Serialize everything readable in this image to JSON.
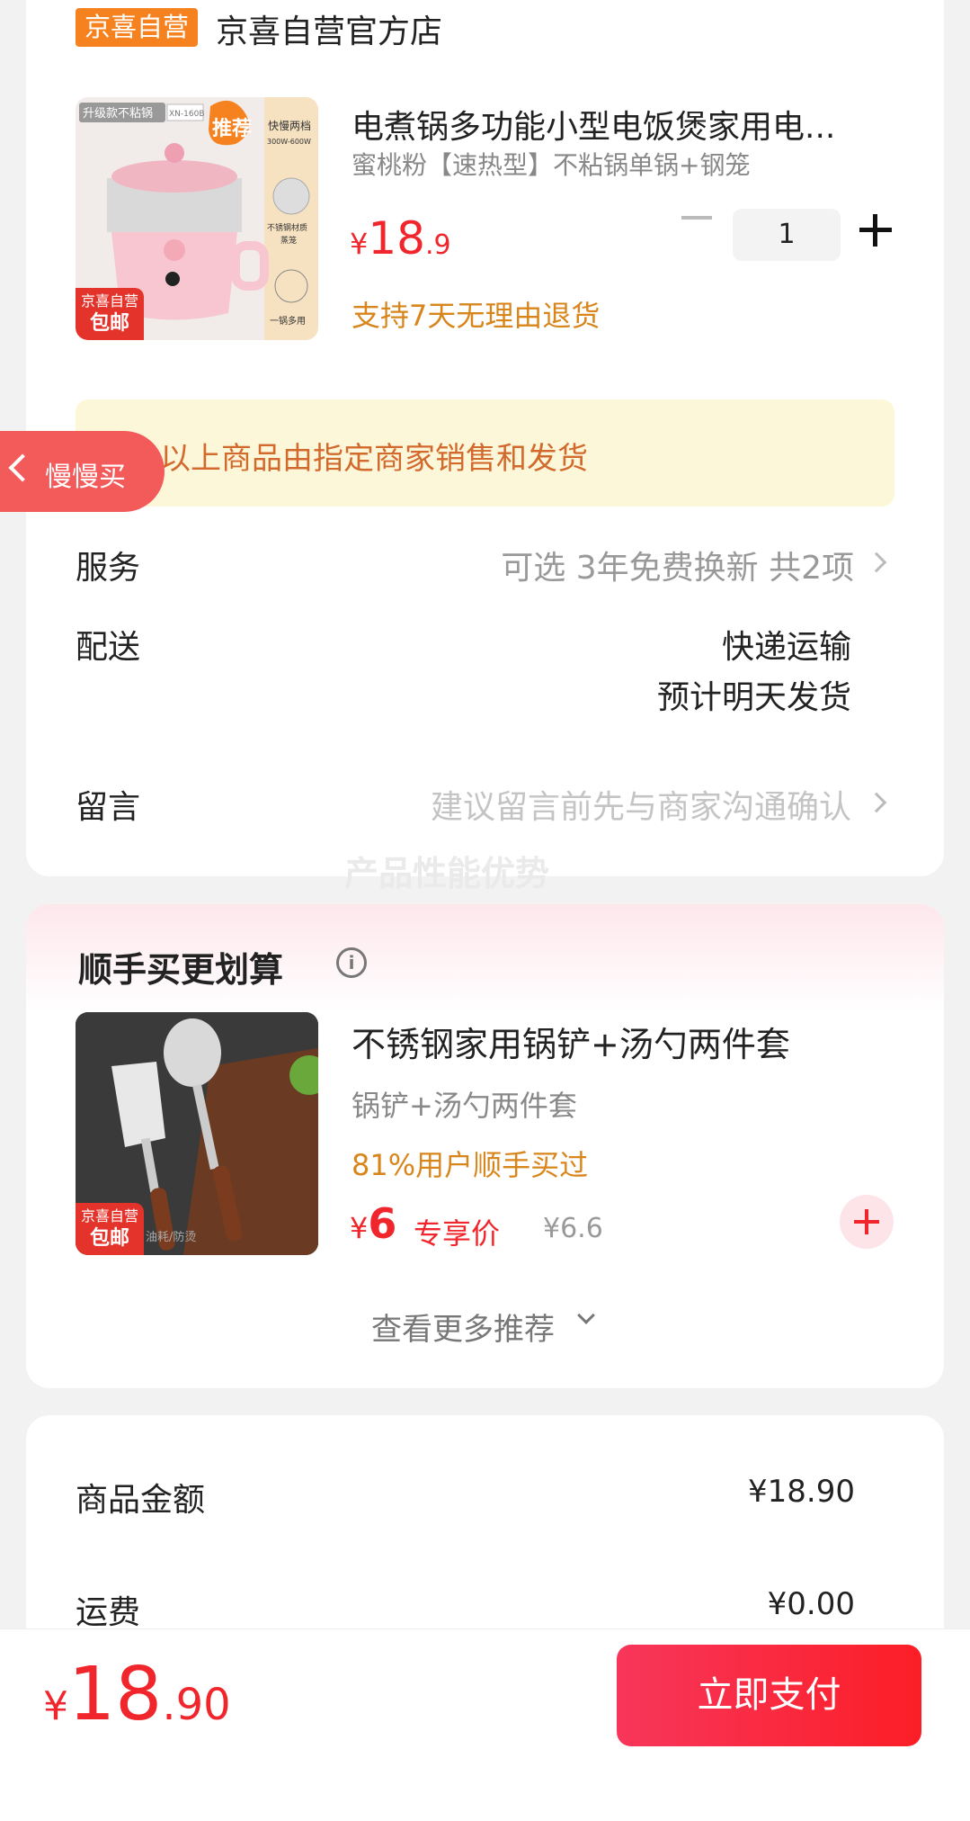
{
  "store": {
    "badge": "京喜自营",
    "name": "京喜自营官方店"
  },
  "product": {
    "title": "电煮锅多功能小型电饭煲家用电...",
    "variant": "蜜桃粉【速热型】不粘锅单锅+钢笼",
    "price_currency": "¥",
    "price_int": "18",
    "price_dec": ".9",
    "quantity": "1",
    "return_policy": "支持7天无理由退货",
    "tag_top": "京喜自营",
    "tag_bottom": "包邮"
  },
  "notice": {
    "icon": "i",
    "text": "以上商品由指定商家销售和发货"
  },
  "slow_buy": {
    "label": "慢慢买"
  },
  "service": {
    "label": "服务",
    "value": "可选 3年免费换新 共2项"
  },
  "delivery": {
    "label": "配送",
    "method": "快递运输",
    "eta": "预计明天发货"
  },
  "message": {
    "label": "留言",
    "placeholder": "建议留言前先与商家沟通确认"
  },
  "ghost_text": "产品性能优势",
  "addon": {
    "section_title": "顺手买更划算",
    "info_icon": "i",
    "title": "不锈钢家用锅铲+汤勺两件套",
    "variant": "锅铲+汤勺两件套",
    "bought_rate": "81%用户顺手买过",
    "price_currency": "¥",
    "price": "6",
    "price_label": "专享价",
    "original_price": "¥6.6",
    "tag_top": "京喜自营",
    "tag_bottom": "包邮",
    "img_caption": "油耗/防烫",
    "more": "查看更多推荐"
  },
  "summary": {
    "goods_label": "商品金额",
    "goods_value": "¥18.90",
    "shipping_label": "运费",
    "shipping_value": "¥0.00"
  },
  "checkout": {
    "currency": "¥",
    "total_int": "18",
    "total_dec": ".90",
    "pay_label": "立即支付"
  },
  "colors": {
    "accent": "#f0262c",
    "badge": "#f5821f",
    "notice_text": "#d26a2e",
    "promo_text": "#d8861c"
  },
  "image_labels": {
    "p1_upgrade": "升级款不粘锅",
    "p1_model": "XN-160B",
    "p1_recommend": "推荐",
    "p1_speed": "快慢两档",
    "p1_power": "300W-600W",
    "p1_steamer": "不锈钢材质\n蒸笼\n*1",
    "p1_multi": "一锅多用"
  }
}
